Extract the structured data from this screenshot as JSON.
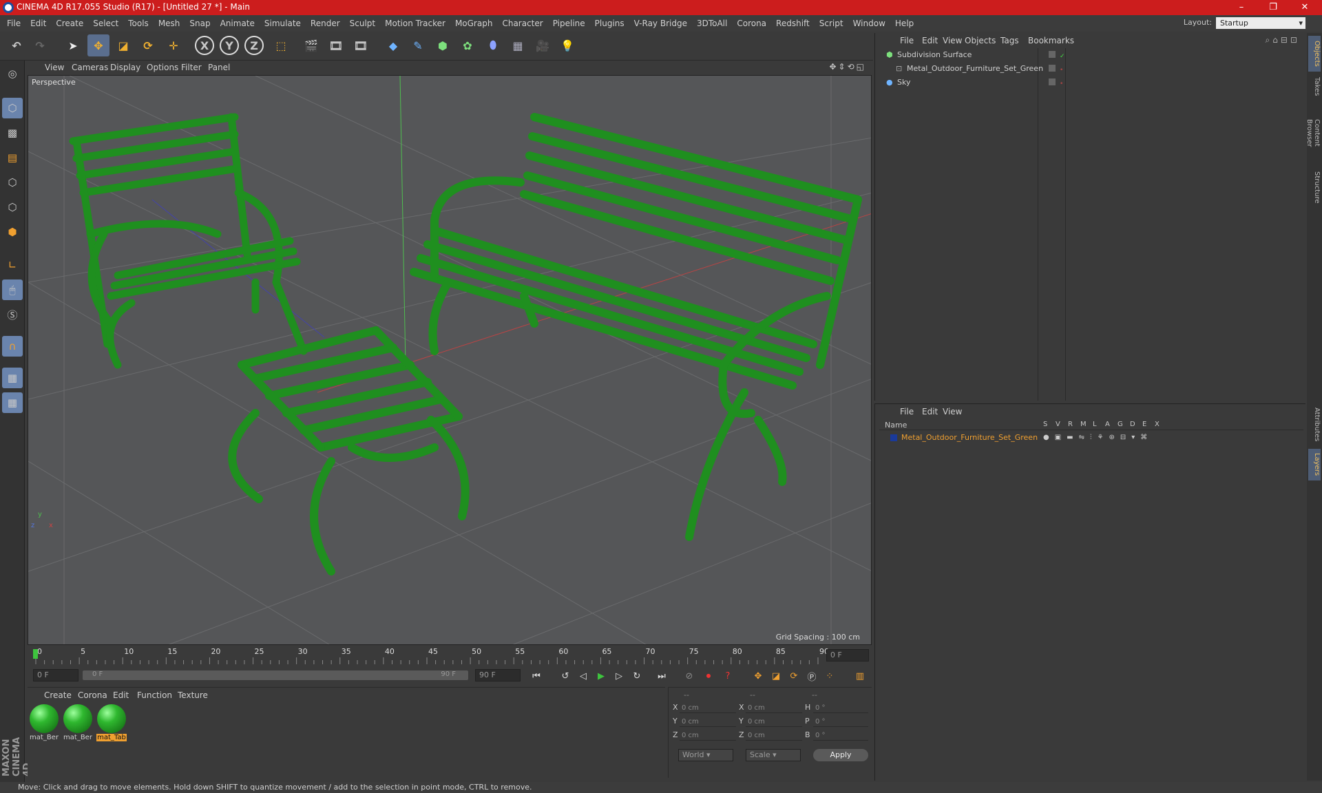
{
  "window": {
    "title": "CINEMA 4D R17.055 Studio (R17) - [Untitled 27 *] - Main",
    "min": "–",
    "max": "❐",
    "close": "✕"
  },
  "menu": [
    "File",
    "Edit",
    "Create",
    "Select",
    "Tools",
    "Mesh",
    "Snap",
    "Animate",
    "Simulate",
    "Render",
    "Sculpt",
    "Motion Tracker",
    "MoGraph",
    "Character",
    "Pipeline",
    "Plugins",
    "V-Ray Bridge",
    "3DToAll",
    "Corona",
    "Redshift",
    "Script",
    "Window",
    "Help"
  ],
  "layout": {
    "label": "Layout:",
    "value": "Startup"
  },
  "toolbar": {
    "x": "X",
    "y": "Y",
    "z": "Z"
  },
  "viewport": {
    "menu": [
      "View",
      "Cameras",
      "Display",
      "Options",
      "Filter",
      "Panel"
    ],
    "label": "Perspective",
    "grid_spacing": "Grid Spacing : 100 cm"
  },
  "timeline": {
    "ticks": [
      "0",
      "5",
      "10",
      "15",
      "20",
      "25",
      "30",
      "35",
      "40",
      "45",
      "50",
      "55",
      "60",
      "65",
      "70",
      "75",
      "80",
      "85",
      "90"
    ],
    "current_frame": "0 F",
    "start": "0 F",
    "range_start": "0 F",
    "range_end": "90 F",
    "end": "90 F"
  },
  "materials": {
    "menu": [
      "Create",
      "Corona",
      "Edit",
      "Function",
      "Texture"
    ],
    "items": [
      {
        "name": "mat_Ber",
        "selected": false
      },
      {
        "name": "mat_Ber",
        "selected": false
      },
      {
        "name": "mat_Tab",
        "selected": true
      }
    ]
  },
  "coords": {
    "headers": [
      "--",
      "--",
      "--"
    ],
    "rows": [
      {
        "a": "X",
        "av": "0 cm",
        "b": "X",
        "bv": "0 cm",
        "c": "H",
        "cv": "0 °"
      },
      {
        "a": "Y",
        "av": "0 cm",
        "b": "Y",
        "bv": "0 cm",
        "c": "P",
        "cv": "0 °"
      },
      {
        "a": "Z",
        "av": "0 cm",
        "b": "Z",
        "bv": "0 cm",
        "c": "B",
        "cv": "0 °"
      }
    ],
    "mode1": "World",
    "mode2": "Scale",
    "apply": "Apply"
  },
  "objects": {
    "menu": [
      "File",
      "Edit",
      "View",
      "Objects",
      "Tags",
      "Bookmarks"
    ],
    "items": [
      {
        "name": "Subdivision Surface",
        "indent": 0
      },
      {
        "name": "Metal_Outdoor_Furniture_Set_Green",
        "indent": 1
      },
      {
        "name": "Sky",
        "indent": 0
      }
    ]
  },
  "layers": {
    "menu": [
      "File",
      "Edit",
      "View"
    ],
    "name_col": "Name",
    "cols": [
      "S",
      "V",
      "R",
      "M",
      "L",
      "A",
      "G",
      "D",
      "E",
      "X"
    ],
    "items": [
      {
        "name": "Metal_Outdoor_Furniture_Set_Green"
      }
    ]
  },
  "right_tabs": [
    "Objects",
    "Takes",
    "Content Browser",
    "Structure",
    "Attributes",
    "Layers"
  ],
  "status": "Move: Click and drag to move elements. Hold down SHIFT to quantize movement / add to the selection in point mode, CTRL to remove.",
  "colors": {
    "title_bg": "#cc1d1d",
    "furniture": "#2fb82f",
    "accent": "#f0a030"
  }
}
